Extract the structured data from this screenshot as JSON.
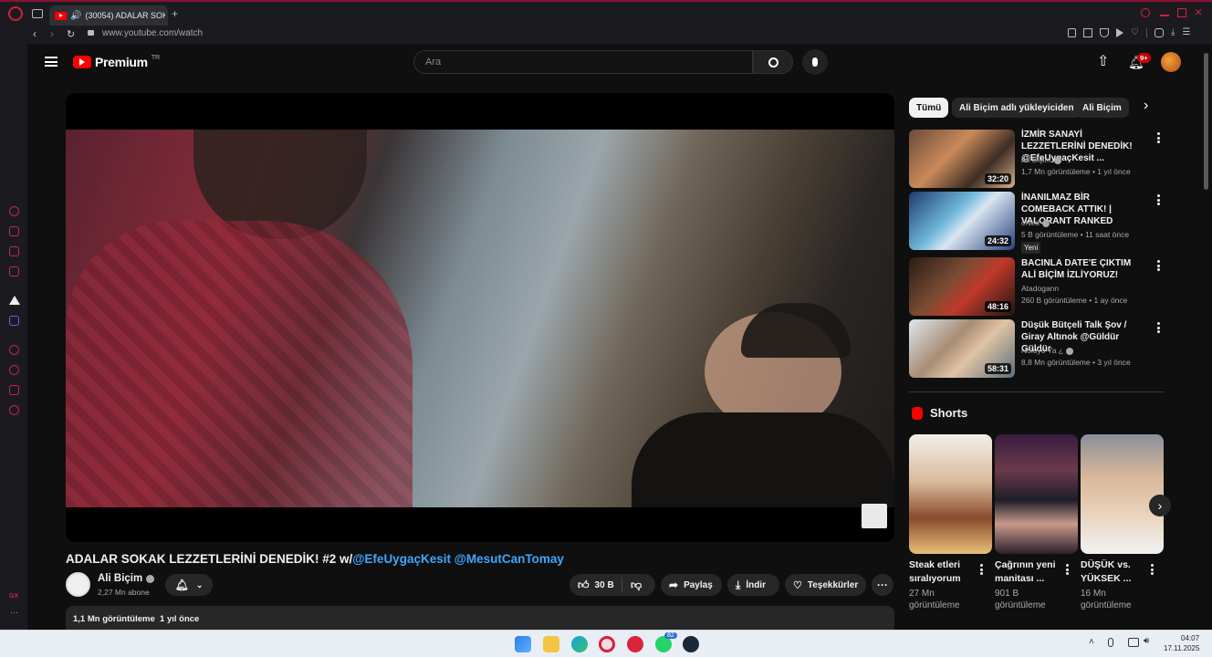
{
  "browser": {
    "tab_title": "(30054) ADALAR SOK",
    "url": "www.youtube.com/watch",
    "colors": {
      "accent": "#c2284a",
      "frame": "#1b1b1f"
    }
  },
  "header": {
    "logo_text": "Premium",
    "logo_region": "TR",
    "search_placeholder": "Ara",
    "notification_count": "9+"
  },
  "video": {
    "title_plain": "ADALAR SOKAK LEZZETLERİNİ DENEDİK! #2 w/",
    "title_links": [
      "@EfeUygaçKesit",
      "@MesutCanTomay"
    ]
  },
  "channel": {
    "name": "Ali Biçim",
    "subscribers": "2,27 Mn abone"
  },
  "actions": {
    "likes": "30 B",
    "share": "Paylaş",
    "download": "İndir",
    "thanks": "Teşekkürler"
  },
  "description": {
    "views": "1,1 Mn görüntüleme",
    "age": "1 yıl önce"
  },
  "chips": [
    "Tümü",
    "Ali Biçim adlı yükleyiciden",
    "Ali Biçim"
  ],
  "recommendations": [
    {
      "title": "İZMİR SANAYİ LEZZETLERİNİ DENEDİK! @EfeUygaçKesit ...",
      "channel": "Ali Biçim",
      "meta": "1,7 Mn görüntüleme • 1 yıl önce",
      "duration": "32:20",
      "verified": true,
      "badge": ""
    },
    {
      "title": "İNANILMAZ BİR COMEBACK ATTIK! | VALORANT RANKED",
      "channel": "cNed",
      "meta": "5 B görüntüleme • 11 saat önce",
      "duration": "24:32",
      "verified": true,
      "badge": "Yeni"
    },
    {
      "title": "BACINLA DATE'E ÇIKTIM ALİ BİÇİM İZLİYORUZ!",
      "channel": "Atadogann",
      "meta": "260 B görüntüleme • 1 ay önce",
      "duration": "48:16",
      "verified": false,
      "badge": ""
    },
    {
      "title": "Düşük Bütçeli Talk Şov / Giray Altınok @Güldür Güldür",
      "channel": "Noluyo Ya ¿",
      "meta": "8,8 Mn görüntüleme • 3 yıl önce",
      "duration": "58:31",
      "verified": true,
      "badge": ""
    }
  ],
  "shorts": {
    "heading": "Shorts",
    "items": [
      {
        "title": "Steak etleri sıralıyorum",
        "meta": "27 Mn görüntüleme"
      },
      {
        "title": "Çağrının yeni manitası ...",
        "meta": "901 B görüntüleme"
      },
      {
        "title": "DÜŞÜK vs. YÜKSEK ...",
        "meta": "16 Mn görüntüleme"
      }
    ]
  },
  "taskbar": {
    "time": "04:07",
    "date": "17.11.2025",
    "whatsapp_badge": "82"
  }
}
